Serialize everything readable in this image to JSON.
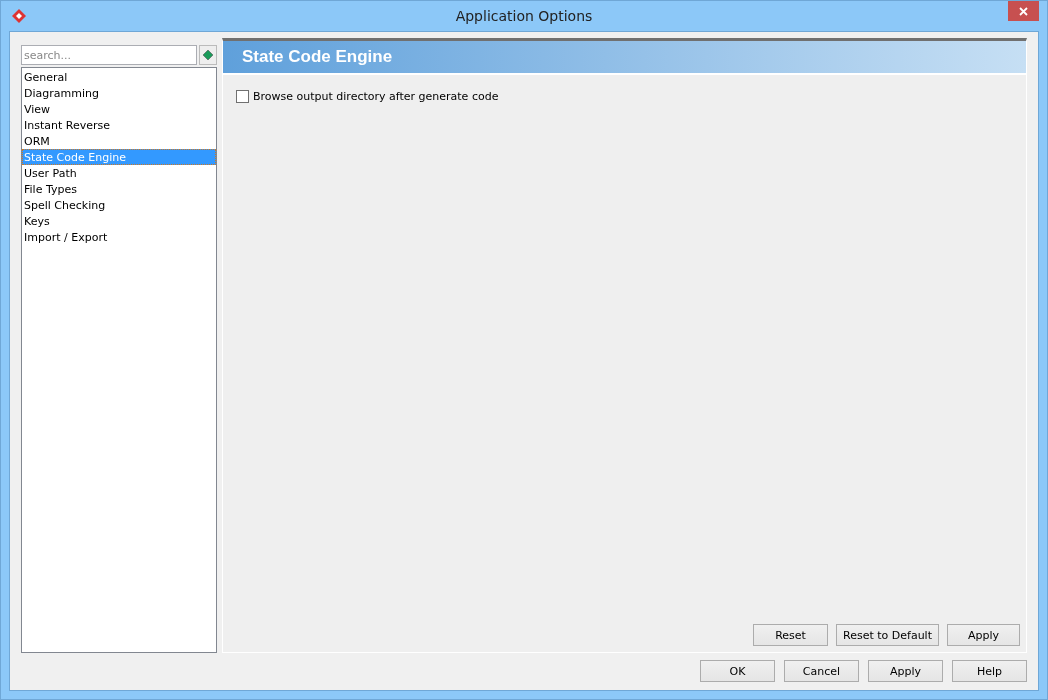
{
  "window": {
    "title": "Application Options"
  },
  "search": {
    "placeholder": "search..."
  },
  "categories": [
    {
      "label": "General",
      "selected": false
    },
    {
      "label": "Diagramming",
      "selected": false
    },
    {
      "label": "View",
      "selected": false
    },
    {
      "label": "Instant Reverse",
      "selected": false
    },
    {
      "label": "ORM",
      "selected": false
    },
    {
      "label": "State Code Engine",
      "selected": true
    },
    {
      "label": "User Path",
      "selected": false
    },
    {
      "label": "File Types",
      "selected": false
    },
    {
      "label": "Spell Checking",
      "selected": false
    },
    {
      "label": "Keys",
      "selected": false
    },
    {
      "label": "Import / Export",
      "selected": false
    }
  ],
  "panel": {
    "title": "State Code Engine",
    "options": [
      {
        "label": "Browse output directory after generate code",
        "checked": false
      }
    ],
    "buttons": [
      "Reset",
      "Reset to Default",
      "Apply"
    ]
  },
  "dialog_buttons": [
    "OK",
    "Cancel",
    "Apply",
    "Help"
  ]
}
